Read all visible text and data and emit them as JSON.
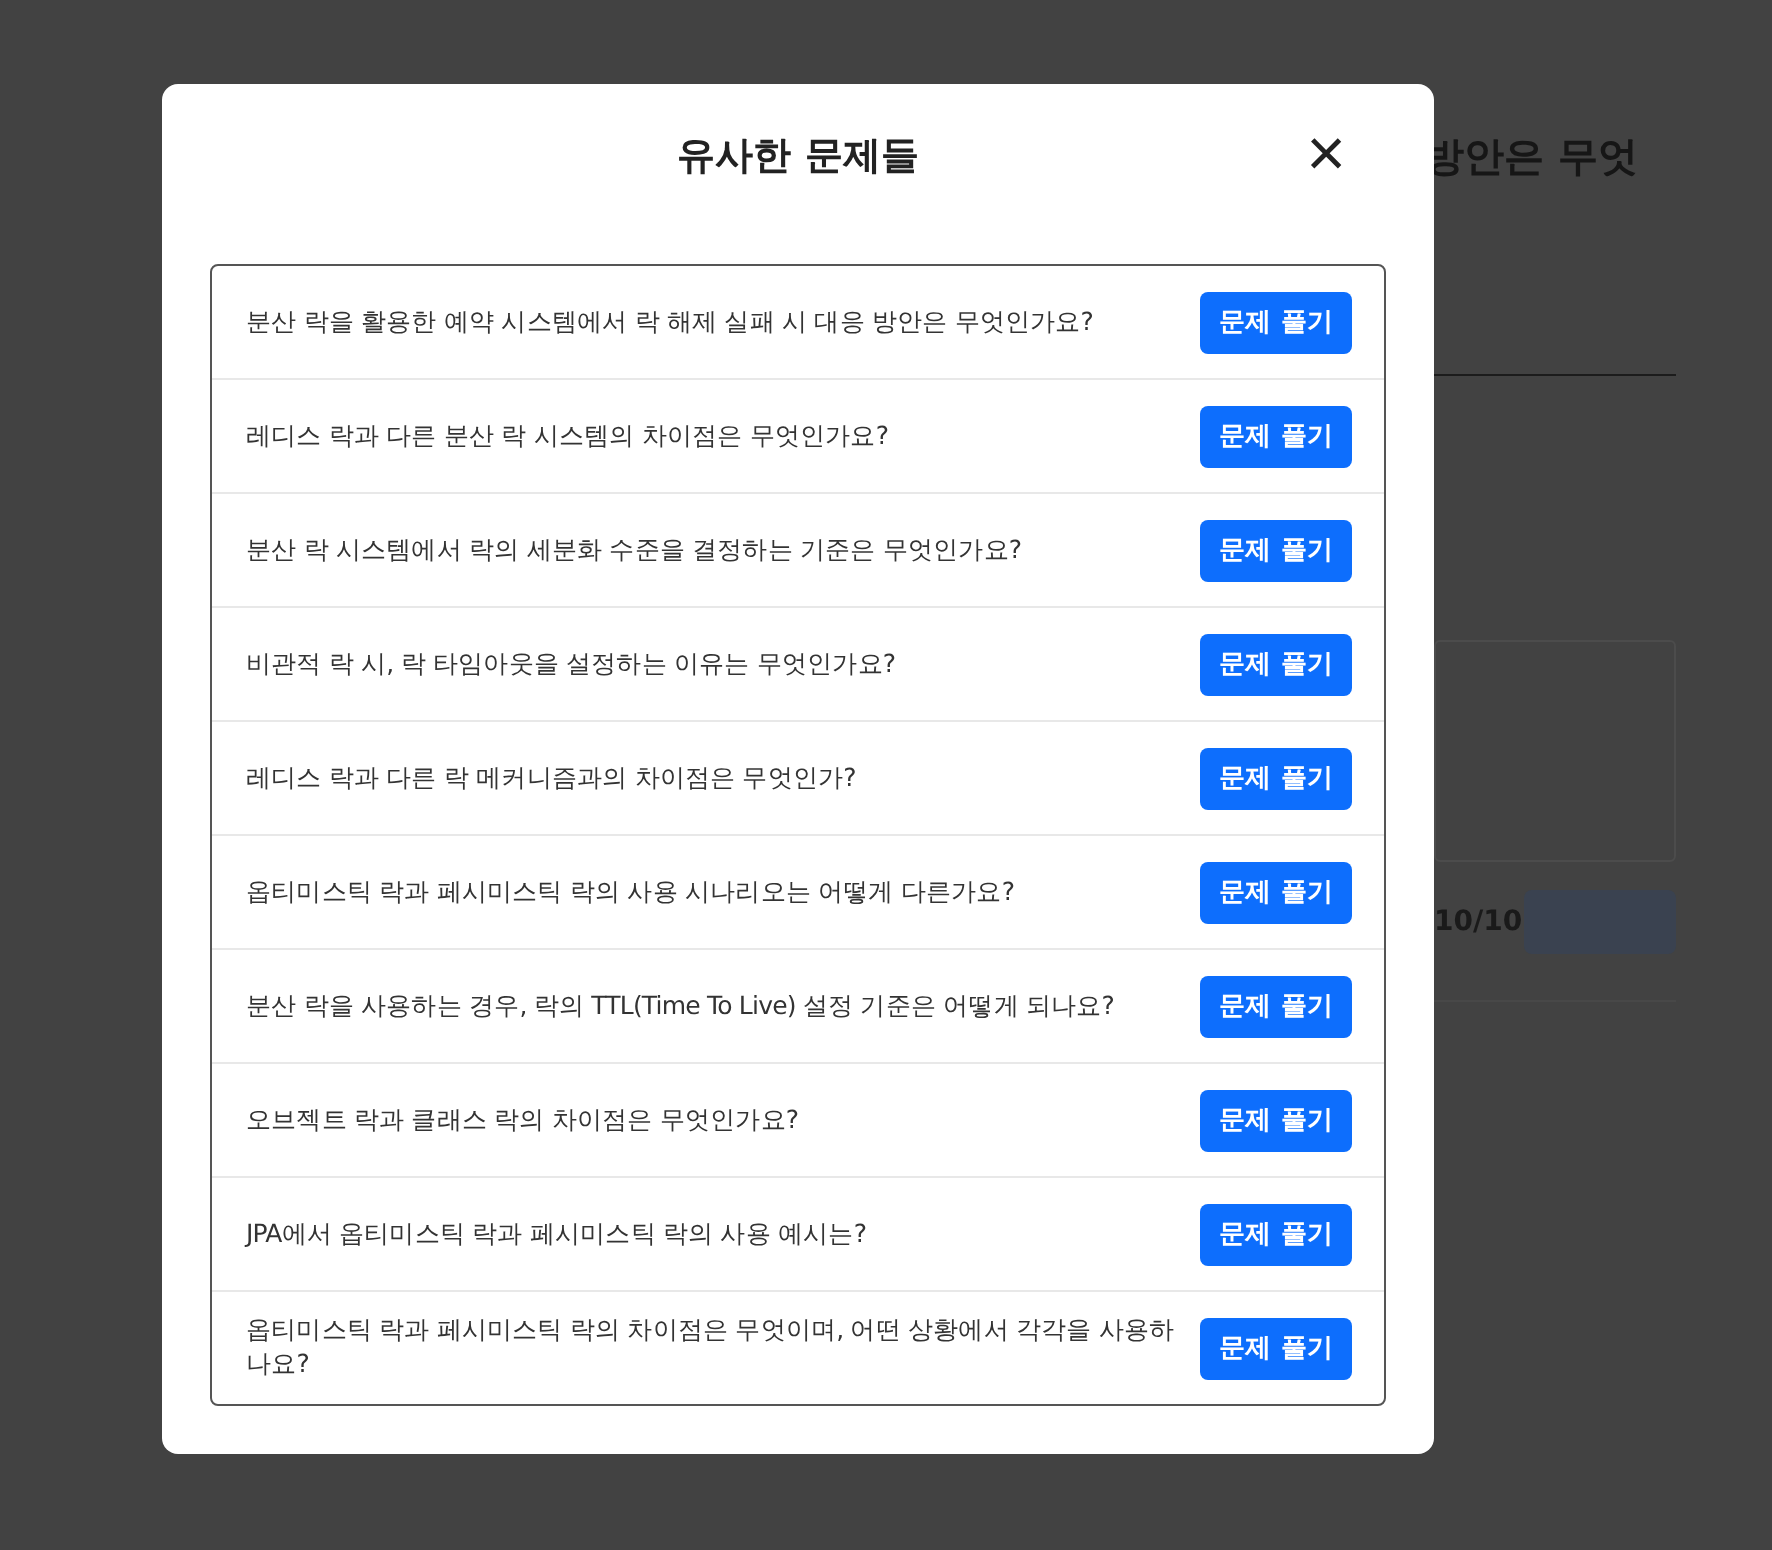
{
  "background_page": {
    "heading": "방안은 무엇",
    "counter": "10/10",
    "submit_button": {
      "disabled": true
    }
  },
  "modal": {
    "title": "유사한 문제들",
    "close": "×",
    "problems": [
      {
        "question": "분산 락을 활용한 예약 시스템에서 락 해제 실패 시 대응 방안은 무엇인가요?",
        "button": "문제 풀기"
      },
      {
        "question": "레디스 락과 다른 분산 락 시스템의 차이점은 무엇인가요?",
        "button": "문제 풀기"
      },
      {
        "question": "분산 락 시스템에서 락의 세분화 수준을 결정하는 기준은 무엇인가요?",
        "button": "문제 풀기"
      },
      {
        "question": "비관적 락 시, 락 타임아웃을 설정하는 이유는 무엇인가요?",
        "button": "문제 풀기"
      },
      {
        "question": "레디스 락과 다른 락 메커니즘과의 차이점은 무엇인가?",
        "button": "문제 풀기"
      },
      {
        "question": "옵티미스틱 락과 페시미스틱 락의 사용 시나리오는 어떻게 다른가요?",
        "button": "문제 풀기"
      },
      {
        "question": "분산 락을 사용하는 경우, 락의 TTL(Time To Live) 설정 기준은 어떻게 되나요?",
        "button": "문제 풀기"
      },
      {
        "question": "오브젝트 락과 클래스 락의 차이점은 무엇인가요?",
        "button": "문제 풀기"
      },
      {
        "question": "JPA에서 옵티미스틱 락과 페시미스틱 락의 사용 예시는?",
        "button": "문제 풀기"
      },
      {
        "question": "옵티미스틱 락과 페시미스틱 락의 차이점은 무엇이며, 어떤 상황에서 각각을 사용하나요?",
        "button": "문제 풀기"
      }
    ]
  }
}
